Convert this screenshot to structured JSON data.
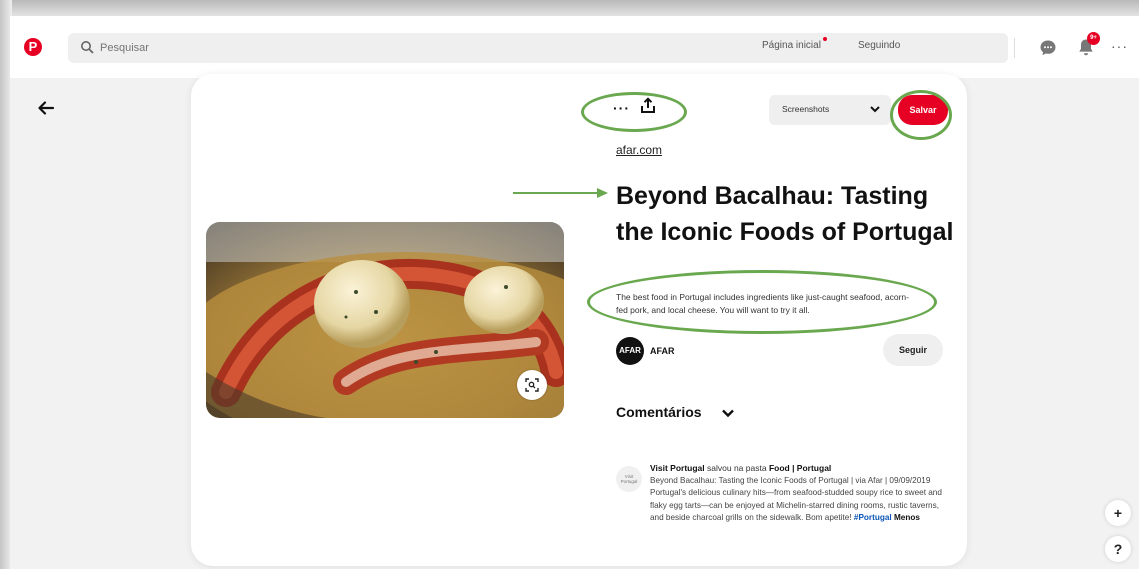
{
  "header": {
    "logo": "P",
    "search_placeholder": "Pesquisar",
    "nav_home": "Página inicial",
    "nav_following": "Seguindo",
    "notifications_badge": "9+",
    "more": "···"
  },
  "pin": {
    "more": "···",
    "board": "Screenshots",
    "save_label": "Salvar",
    "source": "afar.com",
    "title": "Beyond Bacalhau: Tasting the Iconic Foods of Portugal",
    "description": "The best food in Portugal includes ingredients like just-caught seafood, acorn-fed pork, and local cheese. You will want to try it all.",
    "author_avatar": "AFAR",
    "author": "AFAR",
    "follow_label": "Seguir"
  },
  "comments": {
    "heading": "Comentários",
    "avatar_text": "Visit Portugal",
    "user": "Visit Portugal",
    "action": "salvou na pasta",
    "board": "Food | Portugal",
    "body": "Beyond Bacalhau: Tasting the Iconic Foods of Portugal | via Afar | 09/09/2019 Portugal's delicious culinary hits—from seafood-studded soupy rice to sweet and flaky egg tarts—can be enjoyed at Michelin-starred dining rooms, rustic taverns, and beside charcoal grills on the sidewalk. Bom apetite!",
    "hashtag": "#Portugal",
    "less": "Menos"
  },
  "fabs": {
    "plus": "+",
    "help": "?"
  },
  "colors": {
    "brand": "#e60023",
    "annotation": "#6aa84f"
  }
}
